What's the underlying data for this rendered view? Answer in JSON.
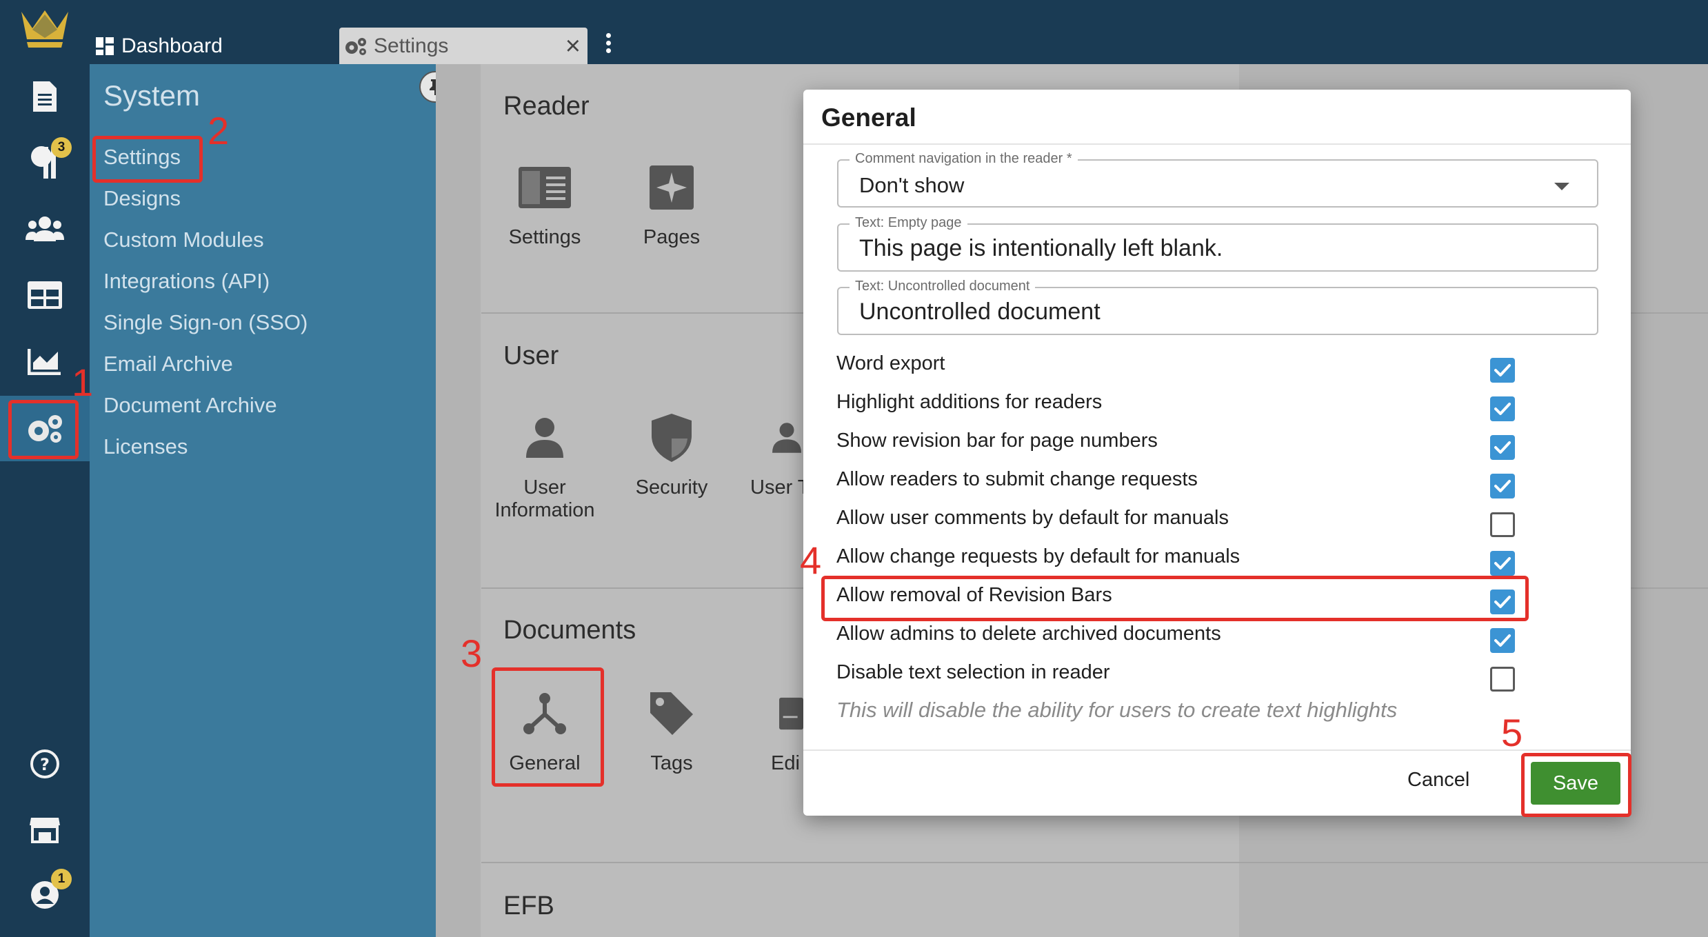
{
  "colors": {
    "topbar": "#1a3b54",
    "sidebar": "#3b7a9c",
    "rail_active": "#2e6a8e",
    "checkbox_on": "#3b94d4",
    "save": "#3f8f30",
    "annotation": "#e4302a",
    "badge": "#e2c14a"
  },
  "tabs": {
    "dashboard_label": "Dashboard",
    "settings_label": "Settings",
    "close_icon": "close-icon",
    "more_icon": "more-vertical-icon"
  },
  "rail": {
    "icons": [
      "crown-logo",
      "document-icon",
      "paragraph-icon",
      "users-icon",
      "table-icon",
      "chart-icon",
      "gears-icon",
      "help-icon",
      "store-icon",
      "account-icon"
    ],
    "paragraph_badge": "3",
    "account_badge": "1"
  },
  "sidebar": {
    "title": "System",
    "items": [
      {
        "label": "Settings"
      },
      {
        "label": "Designs"
      },
      {
        "label": "Custom Modules"
      },
      {
        "label": "Integrations (API)"
      },
      {
        "label": "Single Sign-on (SSO)"
      },
      {
        "label": "Email Archive"
      },
      {
        "label": "Document Archive"
      },
      {
        "label": "Licenses"
      }
    ]
  },
  "main": {
    "reader": {
      "title": "Reader",
      "tiles": [
        "Settings",
        "Pages"
      ]
    },
    "user": {
      "title": "User",
      "tiles": [
        "User Information",
        "Security",
        "User T"
      ]
    },
    "documents": {
      "title": "Documents",
      "tiles": [
        "General",
        "Tags",
        "Edi"
      ]
    },
    "efb": {
      "title": "EFB"
    }
  },
  "dialog": {
    "title": "General",
    "fields": [
      {
        "label": "Comment navigation in the reader *",
        "value": "Don't show"
      },
      {
        "label": "Text: Empty page",
        "value": "This page is intentionally left blank."
      },
      {
        "label": "Text: Uncontrolled document",
        "value": "Uncontrolled document"
      }
    ],
    "options": [
      {
        "label": "Word export",
        "checked": true
      },
      {
        "label": "Highlight additions for readers",
        "checked": true
      },
      {
        "label": "Show revision bar for page numbers",
        "checked": true
      },
      {
        "label": "Allow readers to submit change requests",
        "checked": true
      },
      {
        "label": "Allow user comments by default for manuals",
        "checked": false
      },
      {
        "label": "Allow change requests by default for manuals",
        "checked": true
      },
      {
        "label": "Allow removal of Revision Bars",
        "checked": true
      },
      {
        "label": "Allow admins to delete archived documents",
        "checked": true
      },
      {
        "label": "Disable text selection in reader",
        "checked": false
      }
    ],
    "hint": "This will disable the ability for users to create text highlights",
    "cancel_label": "Cancel",
    "save_label": "Save"
  },
  "annotations": [
    "1",
    "2",
    "3",
    "4",
    "5"
  ]
}
